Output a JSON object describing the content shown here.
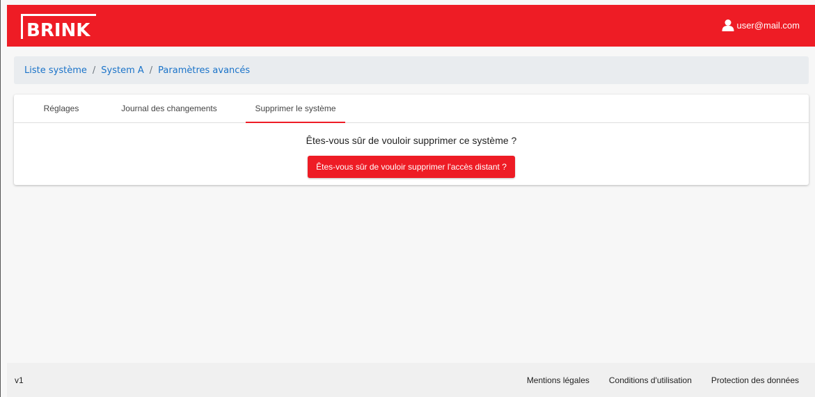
{
  "header": {
    "logo_text": "BRINK",
    "user_email": "user@mail.com",
    "brand_color": "#ee1c25"
  },
  "breadcrumb": {
    "items": [
      "Liste système",
      "System A",
      "Paramètres avancés"
    ],
    "separator": "/"
  },
  "tabs": {
    "items": [
      {
        "label": "Réglages"
      },
      {
        "label": "Journal des changements"
      },
      {
        "label": "Supprimer le système"
      }
    ],
    "active_index": 2
  },
  "delete_panel": {
    "question": "Êtes-vous sûr de vouloir supprimer ce système ?",
    "button_label": "Êtes-vous sûr de vouloir supprimer l'accès distant ?"
  },
  "footer": {
    "version": "v1",
    "links": [
      "Mentions légales",
      "Conditions d'utilisation",
      "Protection des données"
    ]
  },
  "icons": {
    "user": "user-icon"
  }
}
